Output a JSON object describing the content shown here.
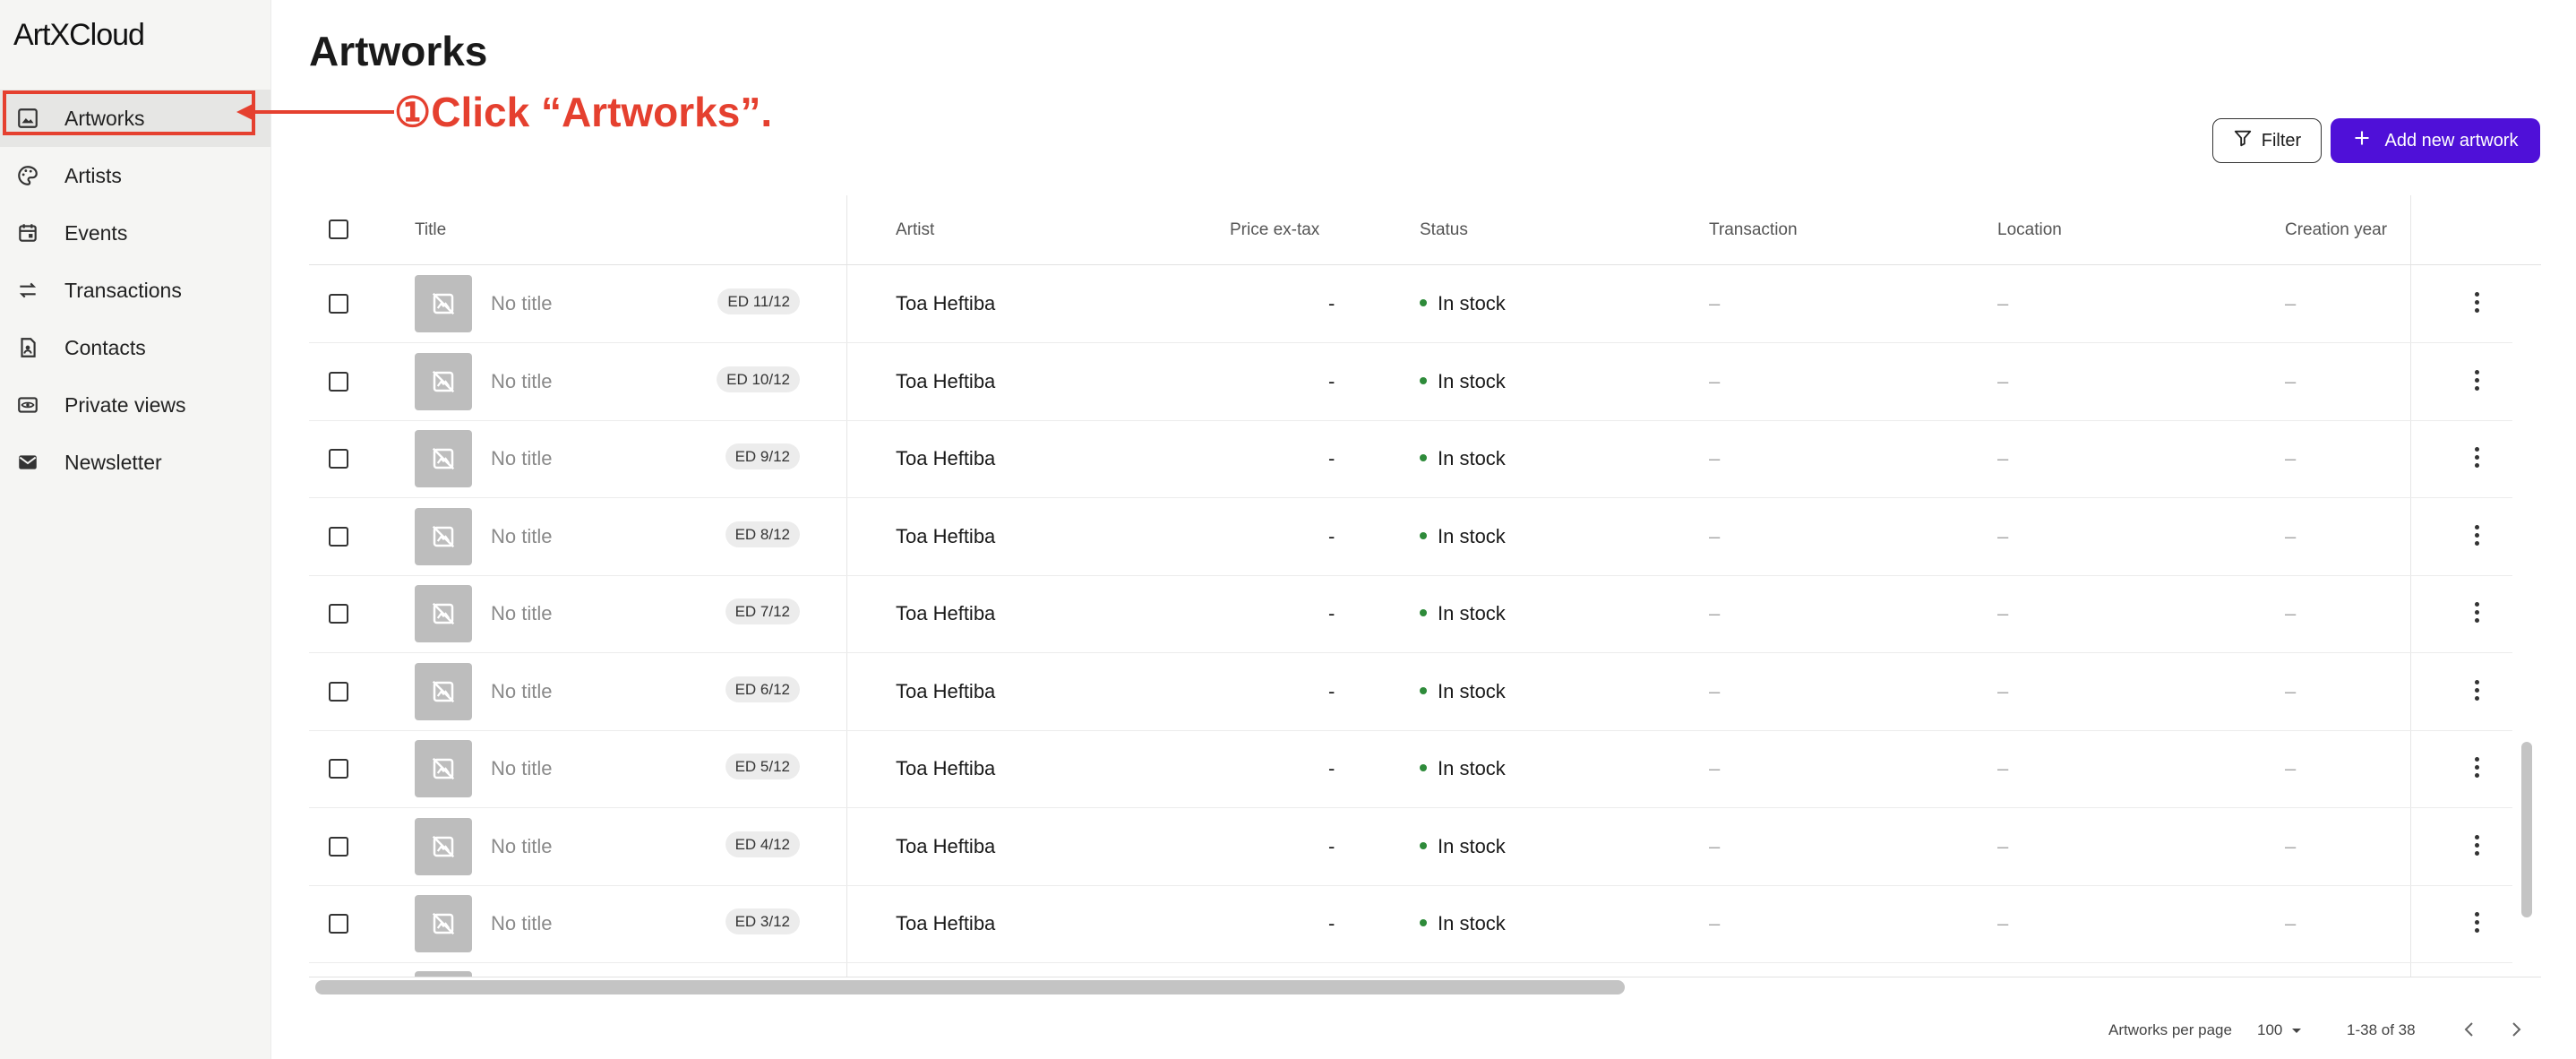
{
  "app": {
    "logo": "ArtXCloud"
  },
  "sidebar": {
    "items": [
      {
        "label": "Artworks",
        "icon": "image-icon"
      },
      {
        "label": "Artists",
        "icon": "palette-icon"
      },
      {
        "label": "Events",
        "icon": "calendar-icon"
      },
      {
        "label": "Transactions",
        "icon": "swap-arrows-icon"
      },
      {
        "label": "Contacts",
        "icon": "contact-card-icon"
      },
      {
        "label": "Private views",
        "icon": "eye-icon"
      },
      {
        "label": "Newsletter",
        "icon": "mail-icon"
      }
    ]
  },
  "annotation": {
    "text": "①Click “Artworks”.",
    "color": "#e5402f"
  },
  "page": {
    "title": "Artworks"
  },
  "toolbar": {
    "filter_label": "Filter",
    "add_label": "Add new artwork",
    "accent": "#4f10d8"
  },
  "table": {
    "columns": [
      "Title",
      "Artist",
      "Price ex-tax",
      "Status",
      "Transaction",
      "Location",
      "Creation year"
    ],
    "rows": [
      {
        "title": "No title",
        "edition": "ED 11/12",
        "artist": "Toa Heftiba",
        "price": "-",
        "status": "In stock",
        "transaction": "–",
        "location": "–",
        "year": "–"
      },
      {
        "title": "No title",
        "edition": "ED 10/12",
        "artist": "Toa Heftiba",
        "price": "-",
        "status": "In stock",
        "transaction": "–",
        "location": "–",
        "year": "–"
      },
      {
        "title": "No title",
        "edition": "ED 9/12",
        "artist": "Toa Heftiba",
        "price": "-",
        "status": "In stock",
        "transaction": "–",
        "location": "–",
        "year": "–"
      },
      {
        "title": "No title",
        "edition": "ED 8/12",
        "artist": "Toa Heftiba",
        "price": "-",
        "status": "In stock",
        "transaction": "–",
        "location": "–",
        "year": "–"
      },
      {
        "title": "No title",
        "edition": "ED 7/12",
        "artist": "Toa Heftiba",
        "price": "-",
        "status": "In stock",
        "transaction": "–",
        "location": "–",
        "year": "–"
      },
      {
        "title": "No title",
        "edition": "ED 6/12",
        "artist": "Toa Heftiba",
        "price": "-",
        "status": "In stock",
        "transaction": "–",
        "location": "–",
        "year": "–"
      },
      {
        "title": "No title",
        "edition": "ED 5/12",
        "artist": "Toa Heftiba",
        "price": "-",
        "status": "In stock",
        "transaction": "–",
        "location": "–",
        "year": "–"
      },
      {
        "title": "No title",
        "edition": "ED 4/12",
        "artist": "Toa Heftiba",
        "price": "-",
        "status": "In stock",
        "transaction": "–",
        "location": "–",
        "year": "–"
      },
      {
        "title": "No title",
        "edition": "ED 3/12",
        "artist": "Toa Heftiba",
        "price": "-",
        "status": "In stock",
        "transaction": "–",
        "location": "–",
        "year": "–"
      }
    ],
    "status_color": "#2e8b3a"
  },
  "footer": {
    "per_page_label": "Artworks per page",
    "per_page_value": "100",
    "range": "1-38 of 38"
  }
}
